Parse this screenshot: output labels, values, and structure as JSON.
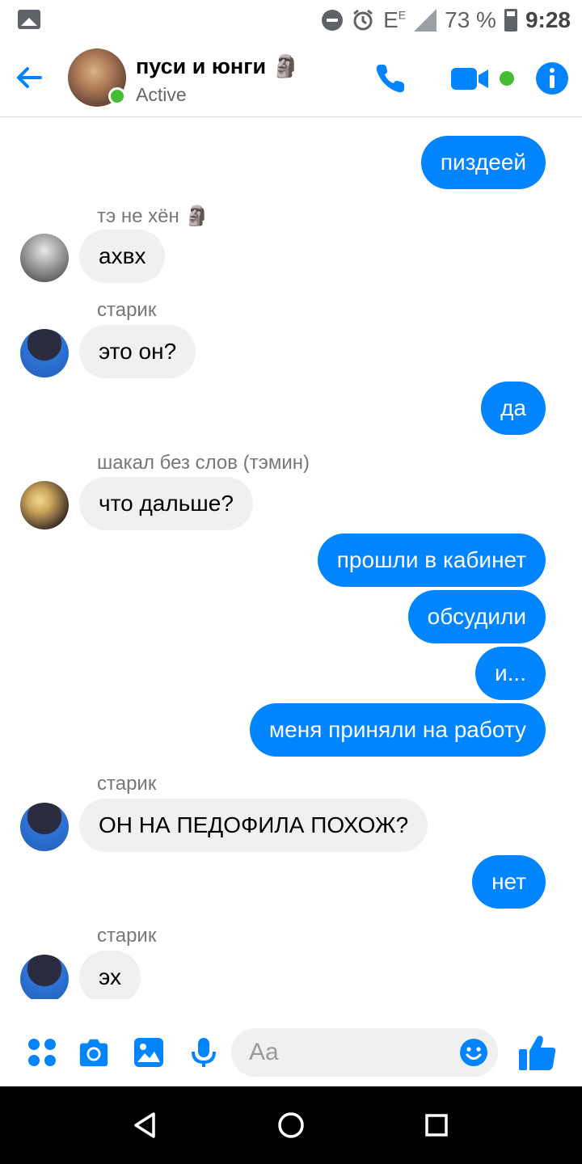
{
  "status_bar": {
    "network": "E",
    "network_sup": "E",
    "battery": "73 %",
    "time": "9:28",
    "icons": [
      "gallery-icon",
      "dnd-icon",
      "alarm-icon",
      "signal-icon",
      "battery-icon"
    ]
  },
  "header": {
    "title": "пуси и юнги 🗿",
    "status": "Active",
    "icons": [
      "back-arrow-icon",
      "phone-icon",
      "video-camera-icon",
      "info-icon"
    ],
    "accent": "#0084ff",
    "active_color": "#44bd32"
  },
  "messages": [
    {
      "dir": "out",
      "text": "пиздеей"
    },
    {
      "dir": "in",
      "sender": "тэ не хён 🗿",
      "text": "ахвх",
      "avatar": "tae"
    },
    {
      "dir": "in",
      "sender": "старик",
      "text": "это он?",
      "avatar": "old"
    },
    {
      "dir": "out",
      "text": "да"
    },
    {
      "dir": "in",
      "sender": "шакал без слов (тэмин)",
      "text": "что дальше?",
      "avatar": "shakal"
    },
    {
      "dir": "out",
      "text": "прошли в кабинет"
    },
    {
      "dir": "out",
      "text": "обсудили"
    },
    {
      "dir": "out",
      "text": "и..."
    },
    {
      "dir": "out",
      "text": "меня приняли на работу"
    },
    {
      "dir": "in",
      "sender": "старик",
      "text": "ОН НА ПЕДОФИЛА ПОХОЖ?",
      "avatar": "old"
    },
    {
      "dir": "out",
      "text": "нет"
    },
    {
      "dir": "in",
      "sender": "старик",
      "text": "эх",
      "avatar": "old"
    }
  ],
  "composer": {
    "placeholder": "Aa",
    "icons": [
      "apps-grid-icon",
      "camera-icon",
      "image-icon",
      "microphone-icon",
      "emoji-icon",
      "thumbs-up-icon"
    ]
  },
  "nav_bar": {
    "icons": [
      "back-triangle-icon",
      "home-circle-icon",
      "recents-square-icon"
    ]
  },
  "colors": {
    "outgoing_bubble": "#0084ff",
    "incoming_bubble": "#f0f0f0",
    "sender_text": "#777777"
  }
}
